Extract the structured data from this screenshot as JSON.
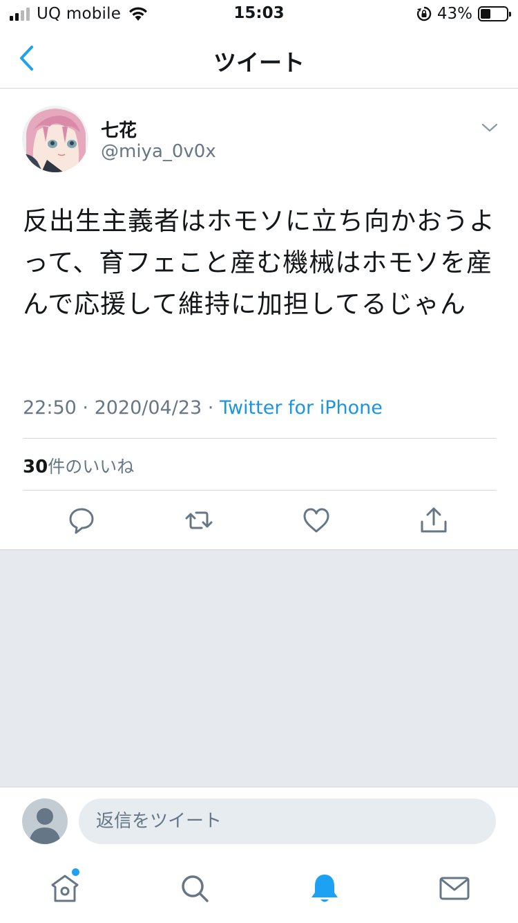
{
  "status_bar": {
    "carrier": "UQ mobile",
    "time": "15:03",
    "battery_percent": "43%"
  },
  "header": {
    "title": "ツイート"
  },
  "tweet": {
    "display_name": "七花",
    "handle": "@miya_0v0x",
    "text": "反出生主義者はホモソに立ち向かおうよって、育フェこと産む機械はホモソを産んで応援して維持に加担してるじゃん",
    "time": "22:50",
    "date": "2020/04/23",
    "separator": " · ",
    "source": "Twitter for iPhone",
    "likes_count": "30",
    "likes_label": "件のいいね"
  },
  "reply": {
    "placeholder": "返信をツイート"
  },
  "colors": {
    "accent": "#1da1f2",
    "link": "#1b95e0",
    "secondary_text": "#657786",
    "divider_area": "#e6e9ed"
  },
  "icons": {
    "back": "chevron-left-icon",
    "caret": "chevron-down-icon",
    "reply": "reply-icon",
    "retweet": "retweet-icon",
    "like": "heart-icon",
    "share": "share-icon",
    "home": "home-icon",
    "search": "search-icon",
    "notifications": "bell-icon",
    "messages": "envelope-icon"
  }
}
